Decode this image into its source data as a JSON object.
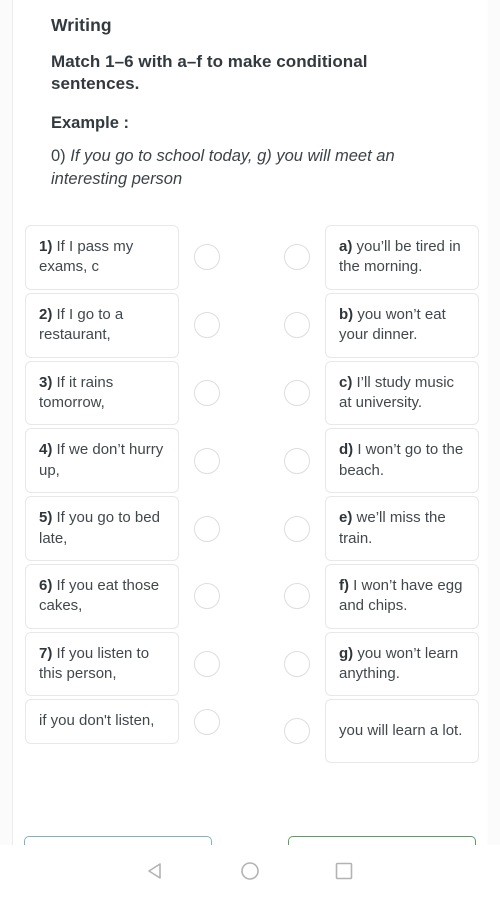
{
  "header": {
    "title": "Writing",
    "instruction": "Match 1–6 with a–f to make conditional sentences.",
    "example_label": "Example :",
    "example_number": "0)",
    "example_text": "If you go to school today, g) you will meet an interesting person"
  },
  "match": {
    "left": [
      {
        "marker": "1)",
        "text": "If I pass my exams, c"
      },
      {
        "marker": "2)",
        "text": "If I go to a restaurant,"
      },
      {
        "marker": "3)",
        "text": "If it rains tomorrow,"
      },
      {
        "marker": "4)",
        "text": "If we don’t hurry up,"
      },
      {
        "marker": "5)",
        "text": "If you go to bed late,"
      },
      {
        "marker": "6)",
        "text": "If you eat those cakes,"
      },
      {
        "marker": "7)",
        "text": "If you listen to this person,"
      },
      {
        "marker": "",
        "text": "if you don't listen,"
      }
    ],
    "right": [
      {
        "marker": "a)",
        "text": "you’ll be tired in the morning."
      },
      {
        "marker": "b)",
        "text": "you won’t eat your dinner."
      },
      {
        "marker": "c)",
        "text": "I’ll study music at university."
      },
      {
        "marker": "d)",
        "text": "I won’t go to the beach."
      },
      {
        "marker": "e)",
        "text": "we’ll miss the train."
      },
      {
        "marker": "f)",
        "text": "I won’t have egg and chips."
      },
      {
        "marker": "g)",
        "text": "you won’t learn anything."
      },
      {
        "marker": "",
        "text": "you will learn a lot."
      }
    ]
  },
  "buttons": {
    "left_color": "#7fb4bb",
    "right_color": "#5a9e60"
  },
  "navbar": {
    "back": "back-triangle",
    "home": "home-circle",
    "recents": "recents-square"
  }
}
